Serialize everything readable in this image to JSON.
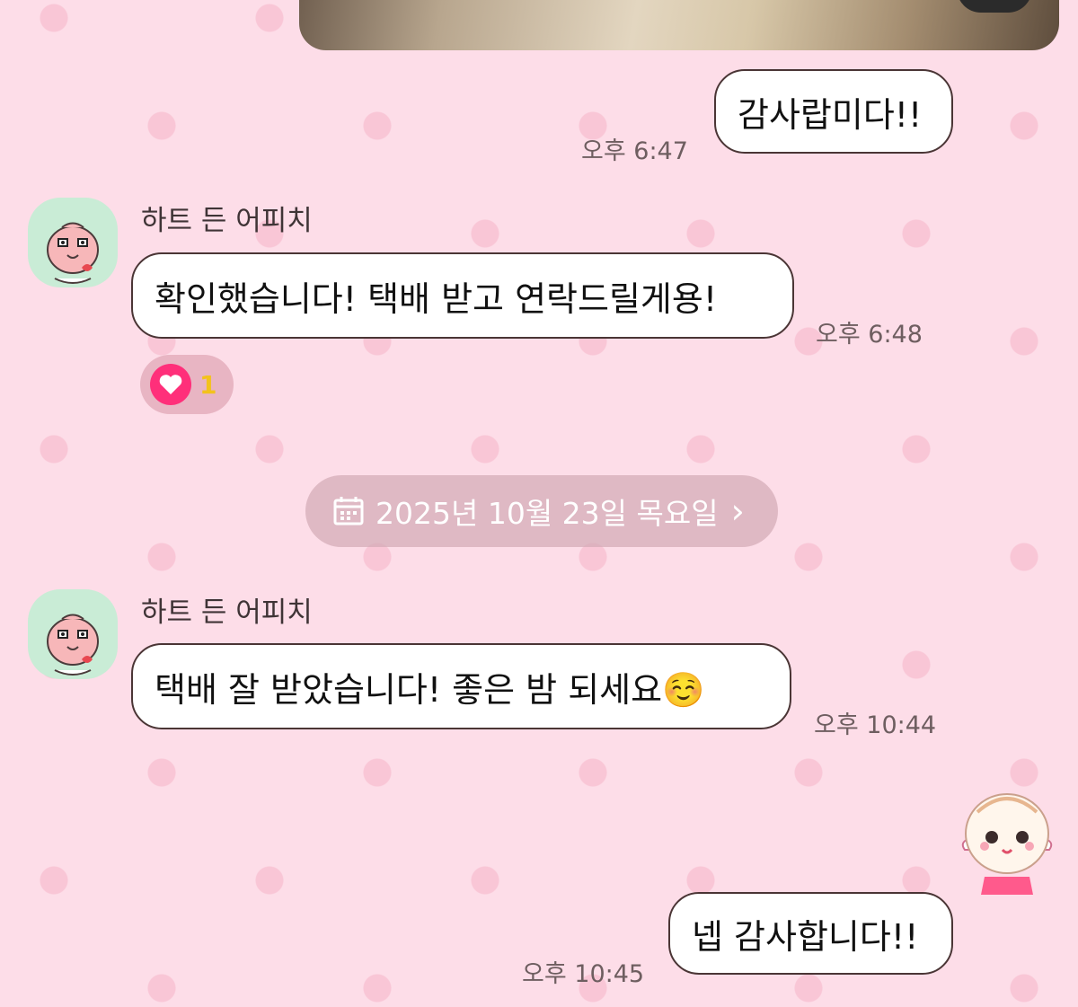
{
  "messages": [
    {
      "id": "m1",
      "side": "me",
      "text": "감사랍미다!!",
      "time": "오후 6:47"
    },
    {
      "id": "m2",
      "side": "them",
      "sender": "하트 든 어피치",
      "text": "확인했습니다! 택배 받고 연락드릴게용!",
      "time": "오후 6:48",
      "reaction": {
        "icon": "heart-icon",
        "count": "1"
      }
    },
    {
      "id": "m3",
      "side": "them",
      "sender": "하트 든 어피치",
      "text": "택배 잘 받았습니다! 좋은 밤 되세요☺️",
      "time": "오후 10:44"
    },
    {
      "id": "m4",
      "side": "me",
      "text": "넵 감사합니다!!",
      "time": "오후 10:45"
    }
  ],
  "date_divider": {
    "label": "2025년 10월 23일 목요일",
    "icon": "calendar-icon",
    "chevron": "›"
  },
  "colors": {
    "background": "#fddde8",
    "bubble_border": "#4a3535",
    "reaction_heart": "#ff2f7a",
    "reaction_count": "#f3c21c",
    "avatar_bg": "#c9ecd6"
  }
}
